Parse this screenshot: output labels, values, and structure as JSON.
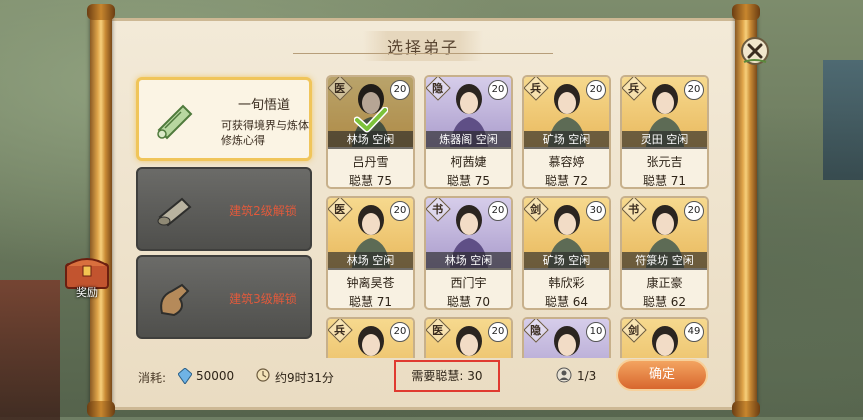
{
  "dialog": {
    "title": "选择弟子"
  },
  "options": [
    {
      "title": "一旬悟道",
      "desc": "可获得境界与炼体修炼心得",
      "locked": false
    },
    {
      "title": "建筑2级解锁",
      "locked": true
    },
    {
      "title": "建筑3级解锁",
      "locked": true
    }
  ],
  "cards": [
    {
      "badge": "医",
      "level": "20",
      "status": "林场 空闲",
      "name": "吕丹雪",
      "wit": "聪慧 75",
      "bg": "gold",
      "selected": true
    },
    {
      "badge": "隐",
      "level": "20",
      "status": "炼器阁 空闲",
      "name": "柯茜婕",
      "wit": "聪慧 75",
      "bg": "purple",
      "selected": false
    },
    {
      "badge": "兵",
      "level": "20",
      "status": "矿场 空闲",
      "name": "慕容婷",
      "wit": "聪慧 72",
      "bg": "gold",
      "selected": false
    },
    {
      "badge": "兵",
      "level": "20",
      "status": "灵田 空闲",
      "name": "张元吉",
      "wit": "聪慧 71",
      "bg": "gold",
      "selected": false
    },
    {
      "badge": "医",
      "level": "20",
      "status": "林场 空闲",
      "name": "钟离昊苍",
      "wit": "聪慧 71",
      "bg": "gold",
      "selected": false
    },
    {
      "badge": "书",
      "level": "20",
      "status": "林场 空闲",
      "name": "西门宇",
      "wit": "聪慧 70",
      "bg": "purple",
      "selected": false
    },
    {
      "badge": "剑",
      "level": "30",
      "status": "矿场 空闲",
      "name": "韩欣彩",
      "wit": "聪慧 64",
      "bg": "gold",
      "selected": false
    },
    {
      "badge": "书",
      "level": "20",
      "status": "符箓坊 空闲",
      "name": "康正豪",
      "wit": "聪慧 62",
      "bg": "gold",
      "selected": false
    },
    {
      "badge": "兵",
      "level": "20",
      "status": "",
      "name": "",
      "wit": "",
      "bg": "gold",
      "selected": false
    },
    {
      "badge": "医",
      "level": "20",
      "status": "",
      "name": "",
      "wit": "",
      "bg": "gold",
      "selected": false
    },
    {
      "badge": "隐",
      "level": "10",
      "status": "",
      "name": "",
      "wit": "",
      "bg": "purple",
      "selected": false
    },
    {
      "badge": "剑",
      "level": "49",
      "status": "",
      "name": "",
      "wit": "",
      "bg": "gold",
      "selected": false
    }
  ],
  "bottom": {
    "cost_label": "消耗:",
    "cost_value": "50000",
    "time_value": "约9时31分",
    "need_wisdom": "需要聪慧: 30",
    "slots": "1/3",
    "confirm": "确定"
  },
  "reward": {
    "label": "奖励"
  },
  "colors": {
    "accent": "#f0c55a",
    "confirm": "#d8672e",
    "highlight": "#e03a30",
    "locked_text": "#e05a3c"
  }
}
